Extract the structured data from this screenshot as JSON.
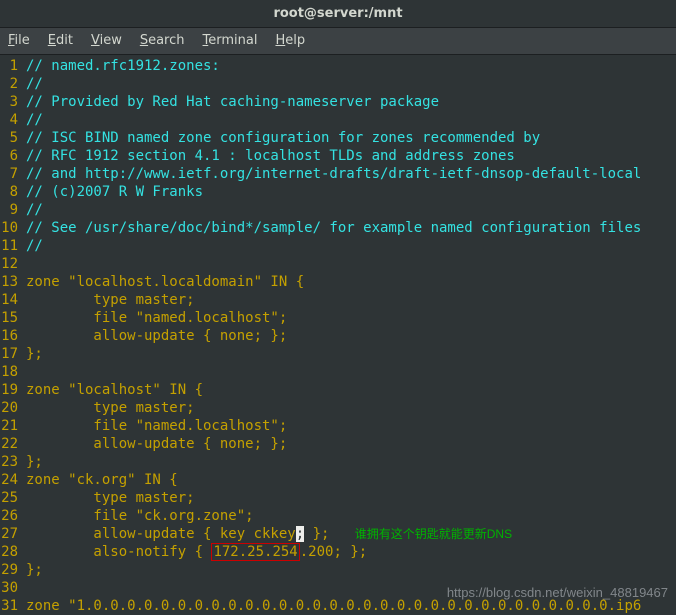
{
  "title": "root@server:/mnt",
  "menu": [
    "File",
    "Edit",
    "View",
    "Search",
    "Terminal",
    "Help"
  ],
  "annotation": "谁拥有这个钥匙就能更新DNS",
  "watermark": "https://blog.csdn.net/weixin_48819467",
  "hl_ip_prefix": "172.25.254",
  "lines": [
    {
      "n": 1,
      "type": "cm",
      "t": "// named.rfc1912.zones:"
    },
    {
      "n": 2,
      "type": "cm",
      "t": "//"
    },
    {
      "n": 3,
      "type": "cm",
      "t": "// Provided by Red Hat caching-nameserver package "
    },
    {
      "n": 4,
      "type": "cm",
      "t": "//"
    },
    {
      "n": 5,
      "type": "cm",
      "t": "// ISC BIND named zone configuration for zones recommended by"
    },
    {
      "n": 6,
      "type": "cm",
      "t": "// RFC 1912 section 4.1 : localhost TLDs and address zones"
    },
    {
      "n": 7,
      "type": "cm",
      "t": "// and http://www.ietf.org/internet-drafts/draft-ietf-dnsop-default-local"
    },
    {
      "n": 8,
      "type": "cm",
      "t": "// (c)2007 R W Franks"
    },
    {
      "n": 9,
      "type": "cm",
      "t": "// "
    },
    {
      "n": 10,
      "type": "cm",
      "t": "// See /usr/share/doc/bind*/sample/ for example named configuration files"
    },
    {
      "n": 11,
      "type": "cm",
      "t": "//"
    },
    {
      "n": 12,
      "type": "id",
      "t": ""
    },
    {
      "n": 13,
      "type": "kw",
      "t": "zone \"localhost.localdomain\" IN {"
    },
    {
      "n": 14,
      "type": "kw",
      "t": "        type master;"
    },
    {
      "n": 15,
      "type": "kw",
      "t": "        file \"named.localhost\";"
    },
    {
      "n": 16,
      "type": "kw",
      "t": "        allow-update { none; };"
    },
    {
      "n": 17,
      "type": "kw",
      "t": "};"
    },
    {
      "n": 18,
      "type": "id",
      "t": ""
    },
    {
      "n": 19,
      "type": "kw",
      "t": "zone \"localhost\" IN {"
    },
    {
      "n": 20,
      "type": "kw",
      "t": "        type master;"
    },
    {
      "n": 21,
      "type": "kw",
      "t": "        file \"named.localhost\";"
    },
    {
      "n": 22,
      "type": "kw",
      "t": "        allow-update { none; };"
    },
    {
      "n": 23,
      "type": "kw",
      "t": "};"
    },
    {
      "n": 24,
      "type": "kw",
      "t": "zone \"ck.org\" IN {"
    },
    {
      "n": 25,
      "type": "kw",
      "t": "        type master;"
    },
    {
      "n": 26,
      "type": "kw",
      "t": "        file \"ck.org.zone\";"
    },
    {
      "n": 27,
      "type": "allow",
      "pre": "        allow-update { key ckkey",
      "cur": ";",
      "post": " };   "
    },
    {
      "n": 28,
      "type": "notify",
      "pre": "        also-notify { ",
      "ip_rest": ".200; };"
    },
    {
      "n": 29,
      "type": "kw",
      "t": "};"
    },
    {
      "n": 30,
      "type": "id",
      "t": ""
    },
    {
      "n": 31,
      "type": "kw",
      "t": "zone \"1.0.0.0.0.0.0.0.0.0.0.0.0.0.0.0.0.0.0.0.0.0.0.0.0.0.0.0.0.0.0.0.ip6"
    }
  ]
}
